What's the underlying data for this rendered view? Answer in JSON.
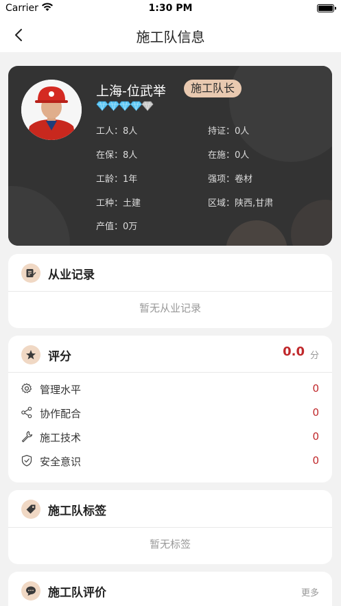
{
  "status_bar": {
    "carrier": "Carrier",
    "time": "1:30 PM"
  },
  "nav": {
    "title": "施工队信息"
  },
  "profile": {
    "name": "上海-位武举",
    "role": "施工队长",
    "diamond_level": 4,
    "diamond_total": 5,
    "left_fields": [
      {
        "label": "工人：",
        "value": "8人"
      },
      {
        "label": "在保：",
        "value": "8人"
      },
      {
        "label": "工龄：",
        "value": "1年"
      },
      {
        "label": "工种：",
        "value": "土建"
      },
      {
        "label": "产值：",
        "value": "0万"
      }
    ],
    "right_fields": [
      {
        "label": "持证：",
        "value": "0人"
      },
      {
        "label": "在施：",
        "value": "0人"
      },
      {
        "label": "强项：",
        "value": "卷材"
      },
      {
        "label": "区域：",
        "value": "陕西,甘肃"
      }
    ]
  },
  "work_history": {
    "title": "从业记录",
    "empty": "暂无从业记录",
    "icon": "edit-icon"
  },
  "rating": {
    "title": "评分",
    "score": "0.0",
    "unit": "分",
    "icon": "star-icon",
    "items": [
      {
        "label": "管理水平",
        "value": "0",
        "icon": "gear-icon"
      },
      {
        "label": "协作配合",
        "value": "0",
        "icon": "share-icon"
      },
      {
        "label": "施工技术",
        "value": "0",
        "icon": "wrench-icon"
      },
      {
        "label": "安全意识",
        "value": "0",
        "icon": "shield-icon"
      }
    ]
  },
  "tags": {
    "title": "施工队标签",
    "empty": "暂无标签",
    "icon": "tag-icon"
  },
  "reviews": {
    "title": "施工队评价",
    "more": "更多",
    "icon": "chat-icon"
  },
  "colors": {
    "accent_red": "#c0282b",
    "badge_bg": "#e9c9b0",
    "card_dark": "#333333",
    "diamond": "#5fc8f5"
  }
}
